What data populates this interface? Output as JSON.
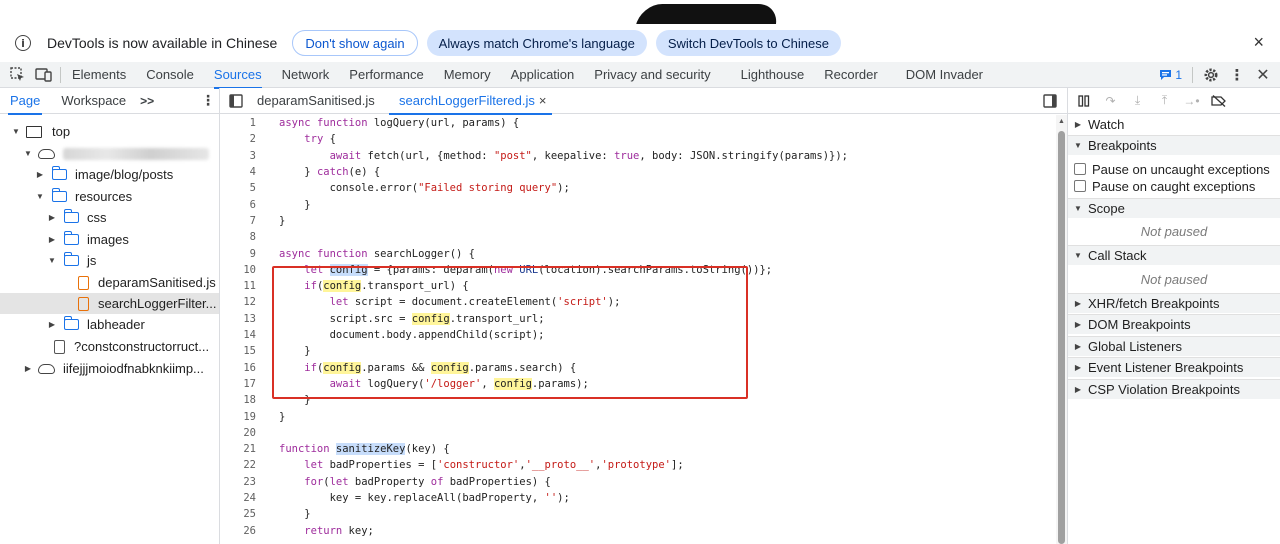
{
  "infobar": {
    "message": "DevTools is now available in Chinese",
    "dont_show": "Don't show again",
    "always_match": "Always match Chrome's language",
    "switch": "Switch DevTools to Chinese",
    "close": "×"
  },
  "toolbar": {
    "tabs": [
      "Elements",
      "Console",
      "Sources",
      "Network",
      "Performance",
      "Memory",
      "Application",
      "Privacy and security",
      "Lighthouse",
      "Recorder",
      "DOM Invader"
    ],
    "active_tab": "Sources",
    "issues_count": "1"
  },
  "navigator": {
    "tabs": [
      "Page",
      "Workspace"
    ],
    "more": ">>",
    "tree": [
      {
        "label": "top"
      },
      {
        "label": ""
      },
      {
        "label": "image/blog/posts"
      },
      {
        "label": "resources"
      },
      {
        "label": "css"
      },
      {
        "label": "images"
      },
      {
        "label": "js"
      },
      {
        "label": "deparamSanitised.js"
      },
      {
        "label": "searchLoggerFilter..."
      },
      {
        "label": "labheader"
      },
      {
        "label": "?constconstructorruct..."
      },
      {
        "label": "iifejjjmoiodfnabknkiimp..."
      }
    ]
  },
  "editor": {
    "tabs": [
      "deparamSanitised.js",
      "searchLoggerFiltered.js"
    ],
    "active_tab": "searchLoggerFiltered.js",
    "tab_close": "×"
  },
  "code_lines": [
    "async function logQuery(url, params) {",
    "    try {",
    "        await fetch(url, {method: \"post\", keepalive: true, body: JSON.stringify(params)});",
    "    } catch(e) {",
    "        console.error(\"Failed storing query\");",
    "    }",
    "}",
    "",
    "async function searchLogger() {",
    "    let config = {params: deparam(new URL(location).searchParams.toString())};",
    "    if(config.transport_url) {",
    "        let script = document.createElement('script');",
    "        script.src = config.transport_url;",
    "        document.body.appendChild(script);",
    "    }",
    "    if(config.params && config.params.search) {",
    "        await logQuery('/logger', config.params);",
    "    }",
    "}",
    "",
    "function sanitizeKey(key) {",
    "    let badProperties = ['constructor','__proto__','prototype'];",
    "    for(let badProperty of badProperties) {",
    "        key = key.replaceAll(badProperty, '');",
    "    }",
    "    return key;"
  ],
  "debugger": {
    "watch": "Watch",
    "breakpoints": "Breakpoints",
    "pause_uncaught": "Pause on uncaught exceptions",
    "pause_caught": "Pause on caught exceptions",
    "scope": "Scope",
    "not_paused": "Not paused",
    "call_stack": "Call Stack",
    "xhr": "XHR/fetch Breakpoints",
    "dom": "DOM Breakpoints",
    "global": "Global Listeners",
    "event": "Event Listener Breakpoints",
    "csp": "CSP Violation Breakpoints"
  }
}
